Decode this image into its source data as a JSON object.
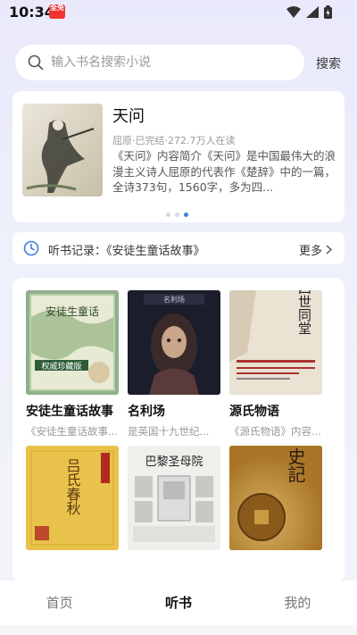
{
  "status_bar": {
    "time": "10:34",
    "badge": "全免"
  },
  "search": {
    "placeholder": "输入书名搜索小说",
    "button_label": "搜索"
  },
  "featured": {
    "title": "天问",
    "meta": "屈原·已完结·272.7万人在读",
    "description": "《天问》内容简介《天问》是中国最伟大的浪漫主义诗人屈原的代表作《楚辞》中的一篇，全诗373句，1560字，多为四...",
    "dot_count": 3,
    "active_dot": 2
  },
  "history": {
    "label": "听书记录：《安徒生童话故事》",
    "more_label": "更多"
  },
  "books": [
    {
      "title": "安徒生童话故事",
      "desc": "《安徒生童话故事...",
      "cover_text": "安徒生童话",
      "cover_sub": "权威珍藏版"
    },
    {
      "title": "名利场",
      "desc": "是英国十九世纪...",
      "cover_text": "名利场"
    },
    {
      "title": "源氏物语",
      "desc": "《源氏物语》内容...",
      "cover_text": "四世同堂"
    },
    {
      "title": "",
      "desc": "",
      "cover_text": "吕氏春秋"
    },
    {
      "title": "",
      "desc": "",
      "cover_text": "巴黎圣母院"
    },
    {
      "title": "",
      "desc": "",
      "cover_text": "史記"
    }
  ],
  "nav": {
    "items": [
      "首页",
      "听书",
      "我的"
    ],
    "active": "听书"
  }
}
